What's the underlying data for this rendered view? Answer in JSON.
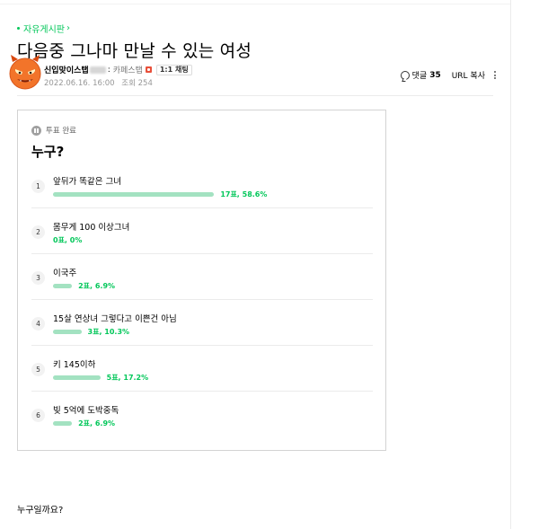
{
  "board": {
    "name": "자유게시판",
    "chevron": "›"
  },
  "post": {
    "title": "다음중 그나마 만날 수 있는 여성",
    "author": {
      "name": "신입맞이스탭",
      "separator": ":",
      "grade": "카페스탭",
      "chat_label": "1:1 채팅"
    },
    "date": "2022.06.16. 16:00",
    "views": "조회 254",
    "body": "누구일까요?"
  },
  "actions": {
    "comment_label": "댓글",
    "comment_count": "35",
    "url_copy": "URL 복사"
  },
  "poll": {
    "status": "투표 완료",
    "question": "누구?",
    "accent_color": "#03c75a",
    "bar_color": "#a3e2c1",
    "options": [
      {
        "num": "1",
        "text": "앞뒤가 똑같은 그녀",
        "votes": 17,
        "pct": 58.6,
        "result": "17표, 58.6%"
      },
      {
        "num": "2",
        "text": "몸무게 100 이상그녀",
        "votes": 0,
        "pct": 0,
        "result": "0표, 0%"
      },
      {
        "num": "3",
        "text": "이국주",
        "votes": 2,
        "pct": 6.9,
        "result": "2표, 6.9%"
      },
      {
        "num": "4",
        "text": "15살 연상녀 그렇다고 이쁜건 아님",
        "votes": 3,
        "pct": 10.3,
        "result": "3표, 10.3%"
      },
      {
        "num": "5",
        "text": "키 145이하",
        "votes": 5,
        "pct": 17.2,
        "result": "5표, 17.2%"
      },
      {
        "num": "6",
        "text": "빚 5억에 도박중독",
        "votes": 2,
        "pct": 6.9,
        "result": "2표, 6.9%"
      }
    ]
  },
  "icons": {
    "avatar": "devil-face-icon",
    "comment": "speech-bubble-icon",
    "more": "vertical-dots-icon",
    "grade": "staff-badge-icon",
    "poll_status": "pause-circle-icon"
  }
}
